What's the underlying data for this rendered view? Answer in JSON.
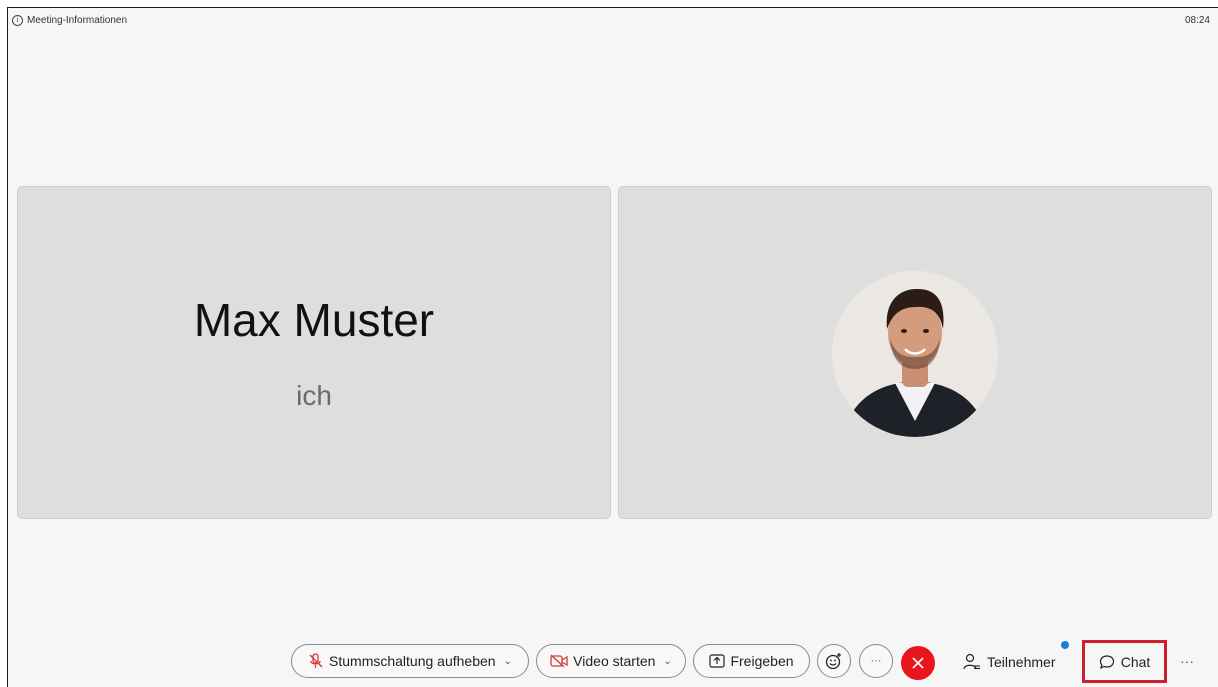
{
  "header": {
    "meeting_info_label": "Meeting-Informationen",
    "time": "08:24"
  },
  "tiles": {
    "self_name": "Max Muster",
    "self_subtitle": "ich"
  },
  "toolbar": {
    "unmute_label": "Stummschaltung aufheben",
    "video_label": "Video starten",
    "share_label": "Freigeben",
    "more_label": "···",
    "participants_label": "Teilnehmer",
    "chat_label": "Chat",
    "overflow_label": "···"
  },
  "colors": {
    "leave": "#e8141e",
    "highlight": "#d01f2c",
    "notification_dot": "#1a7bd8",
    "mic_video_icon": "#d03a3a"
  },
  "icons": {
    "unmute": "microphone-muted-icon",
    "video": "video-off-icon",
    "share": "share-screen-icon",
    "reactions": "emoji-icon",
    "leave": "close-icon",
    "participants": "participants-icon",
    "chat": "chat-bubble-icon"
  }
}
